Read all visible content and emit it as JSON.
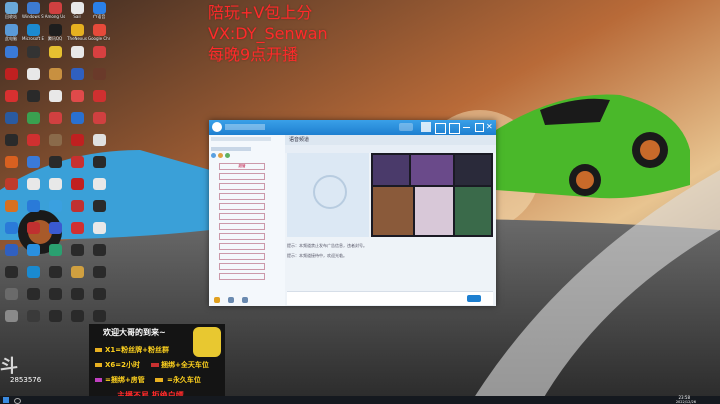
{
  "overlay": {
    "line1": "陪玩+V包上分",
    "line2": "VX:DY_Senwan",
    "line3": "每晚9点开播"
  },
  "desktop_icons": [
    {
      "label": "回收站",
      "color": "#6aa8d8"
    },
    {
      "label": "Windows Startup",
      "color": "#3d7bd0"
    },
    {
      "label": "Among Us",
      "color": "#d04040"
    },
    {
      "label": "Sail",
      "color": "#e8e8e8"
    },
    {
      "label": "YY语音",
      "color": "#2a80e8"
    },
    {
      "label": "此电脑",
      "color": "#5a9ad8"
    },
    {
      "label": "Microsoft Edge",
      "color": "#1c8ad0"
    },
    {
      "label": "腾讯QQ",
      "color": "#1e1e1e"
    },
    {
      "label": "TheNexus",
      "color": "#e6b020"
    },
    {
      "label": "Google Chrome",
      "color": "#e64a3a"
    },
    {
      "label": "",
      "color": "#3a7ad8"
    },
    {
      "label": "",
      "color": "#333"
    },
    {
      "label": "",
      "color": "#e6c030"
    },
    {
      "label": "",
      "color": "#e8e8e8"
    },
    {
      "label": "",
      "color": "#d84040"
    },
    {
      "label": "",
      "color": "#c02020"
    },
    {
      "label": "",
      "color": "#e8e8e8"
    },
    {
      "label": "",
      "color": "#c89040"
    },
    {
      "label": "",
      "color": "#3060c0"
    },
    {
      "label": "",
      "color": "#6a3a2a"
    },
    {
      "label": "",
      "color": "#d83030"
    },
    {
      "label": "",
      "color": "#2a2a2a"
    },
    {
      "label": "",
      "color": "#e8e8e8"
    },
    {
      "label": "",
      "color": "#e04a4a"
    },
    {
      "label": "",
      "color": "#d03030"
    },
    {
      "label": "",
      "color": "#2a5aa0"
    },
    {
      "label": "",
      "color": "#3aa050"
    },
    {
      "label": "",
      "color": "#d04040"
    },
    {
      "label": "",
      "color": "#2a70d0"
    },
    {
      "label": "",
      "color": "#d04040"
    },
    {
      "label": "",
      "color": "#2a2a2a"
    },
    {
      "label": "",
      "color": "#d03030"
    },
    {
      "label": "",
      "color": "#8a6a4a"
    },
    {
      "label": "",
      "color": "#c02020"
    },
    {
      "label": "",
      "color": "#e0e0e0"
    },
    {
      "label": "",
      "color": "#d86020"
    },
    {
      "label": "",
      "color": "#3a7ad8"
    },
    {
      "label": "",
      "color": "#2a2a2a"
    },
    {
      "label": "",
      "color": "#c83030"
    },
    {
      "label": "",
      "color": "#2a2a2a"
    },
    {
      "label": "",
      "color": "#c03a2a"
    },
    {
      "label": "",
      "color": "#e8e8e8"
    },
    {
      "label": "",
      "color": "#e8e8e8"
    },
    {
      "label": "",
      "color": "#c02020"
    },
    {
      "label": "",
      "color": "#e8e8e8"
    },
    {
      "label": "",
      "color": "#d87020"
    },
    {
      "label": "",
      "color": "#2a7ad8"
    },
    {
      "label": "",
      "color": "#3aa0e0"
    },
    {
      "label": "",
      "color": "#c03030"
    },
    {
      "label": "",
      "color": "#2a2a2a"
    },
    {
      "label": "",
      "color": "#2a7ad8"
    },
    {
      "label": "",
      "color": "#c03030"
    },
    {
      "label": "",
      "color": "#3a5ad0"
    },
    {
      "label": "",
      "color": "#d03030"
    },
    {
      "label": "",
      "color": "#e8e8e8"
    },
    {
      "label": "",
      "color": "#3060c0"
    },
    {
      "label": "",
      "color": "#2a90e0"
    },
    {
      "label": "",
      "color": "#2aa070"
    },
    {
      "label": "",
      "color": "#2a2a2a"
    },
    {
      "label": "",
      "color": "#2a2a2a"
    },
    {
      "label": "",
      "color": "#2a2a2a"
    },
    {
      "label": "",
      "color": "#1a8ad0"
    },
    {
      "label": "",
      "color": "#2a2a2a"
    },
    {
      "label": "",
      "color": "#d0a040"
    },
    {
      "label": "",
      "color": "#2a2a2a"
    },
    {
      "label": "",
      "color": "#6a6a6a"
    },
    {
      "label": "",
      "color": "#2a2a2a"
    },
    {
      "label": "",
      "color": "#2a2a2a"
    },
    {
      "label": "",
      "color": "#2a2a2a"
    },
    {
      "label": "",
      "color": "#2a2a2a"
    },
    {
      "label": "",
      "color": "#8a8a8a"
    },
    {
      "label": "",
      "color": "#3a3a3a"
    },
    {
      "label": "",
      "color": "#2a2a2a"
    },
    {
      "label": "",
      "color": "#2a2a2a"
    },
    {
      "label": "",
      "color": "#2a2a2a"
    }
  ],
  "qq_window": {
    "room_title": "语音频道",
    "member_rows": [
      "超管",
      "",
      "",
      "",
      "",
      "",
      "",
      "",
      "",
      "",
      "",
      ""
    ],
    "chat_line1": "提示：本频道禁止发布广告信息，违者封号。",
    "chat_line2": "提示：本频道接待中，欢迎光临。"
  },
  "promo": {
    "title": "欢迎大哥的到来~",
    "l1": "X1=粉丝牌+粉丝群",
    "l2": "X6=2小时",
    "l2b": "捆绑+全天车位",
    "l3": "=捆绑+房管",
    "l3b": "=永久车位",
    "l4": "主播不易 拒绝白嫖"
  },
  "counter": "2853576",
  "taskbar": {
    "time": "23:58",
    "date": "2022/12/26"
  },
  "colors": {
    "overlay_red": "#ff2a2a",
    "promo_yellow": "#ffd21e",
    "qq_blue": "#1d7fd0"
  }
}
